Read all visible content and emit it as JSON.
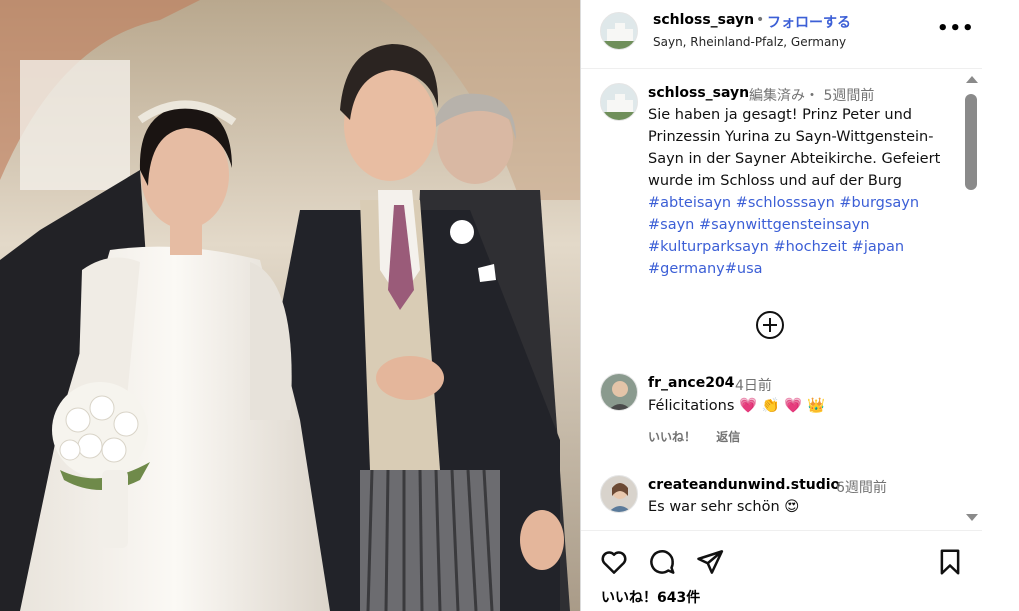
{
  "post": {
    "username": "schloss_sayn",
    "follow_label": "フォローする",
    "separator": "•",
    "location": "Sayn, Rheinland-Pfalz, Germany",
    "more_label": "•••"
  },
  "caption": {
    "username": "schloss_sayn",
    "meta": "編集済み・ 5週間前",
    "text": "Sie haben ja gesagt! Prinz Peter und Prinzessin Yurina zu Sayn-Wittgenstein-Sayn in der Sayner Abteikirche. Gefeiert wurde im Schloss und auf der Burg ",
    "hashtags": [
      "#abteisayn",
      "#schlosssayn",
      "#burgsayn",
      "#sayn",
      "#saynwittgensteinsayn",
      "#kulturparksayn",
      "#hochzeit",
      "#japan",
      "#germany",
      "#usa"
    ]
  },
  "comments": [
    {
      "username": "fr_ance204",
      "time": "4日前",
      "text": "Félicitations 💗 👏 💗 👑",
      "like_label": "いいね！",
      "reply_label": "返信"
    },
    {
      "username": "createandunwind.studio",
      "time": "6週間前",
      "text": "Es war sehr schön 😍"
    }
  ],
  "footer": {
    "likes": "いいね！643件"
  },
  "icons": [
    "heart-icon",
    "comment-icon",
    "share-icon",
    "bookmark-icon",
    "load-more-icon"
  ],
  "colors": {
    "link": "#3c5fd6",
    "muted": "#737373"
  }
}
